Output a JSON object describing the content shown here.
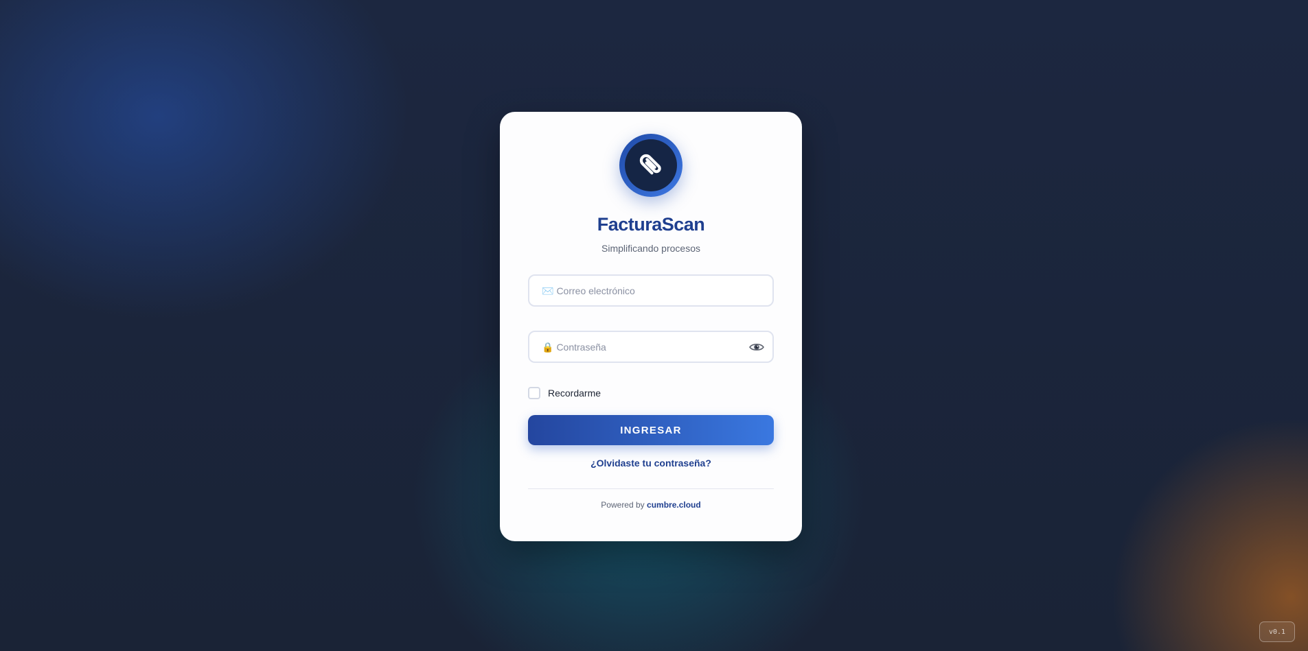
{
  "app": {
    "name": "FacturaScan",
    "tagline": "Simplificando procesos",
    "logo_icon": "paperclip-icon"
  },
  "login_form": {
    "email": {
      "icon": "✉️",
      "icon_name": "email-icon",
      "placeholder": "Correo electrónico",
      "value": ""
    },
    "password": {
      "icon": "🔒",
      "icon_name": "lock-icon",
      "placeholder": "Contraseña",
      "value": "",
      "toggle_icon": "eye-icon"
    },
    "remember_label": "Recordarme",
    "remember_checked": false,
    "submit_label": "INGRESAR",
    "forgot_link": "¿Olvidaste tu contraseña?"
  },
  "footer": {
    "powered_prefix": "Powered by",
    "powered_brand": "cumbre.cloud"
  },
  "version_badge": "v0.1",
  "colors": {
    "brand_primary": "#1f3f8f",
    "button_start": "#24469f",
    "button_end": "#3a78e0",
    "logo_dark": "#152545",
    "background": "#1b2538"
  }
}
